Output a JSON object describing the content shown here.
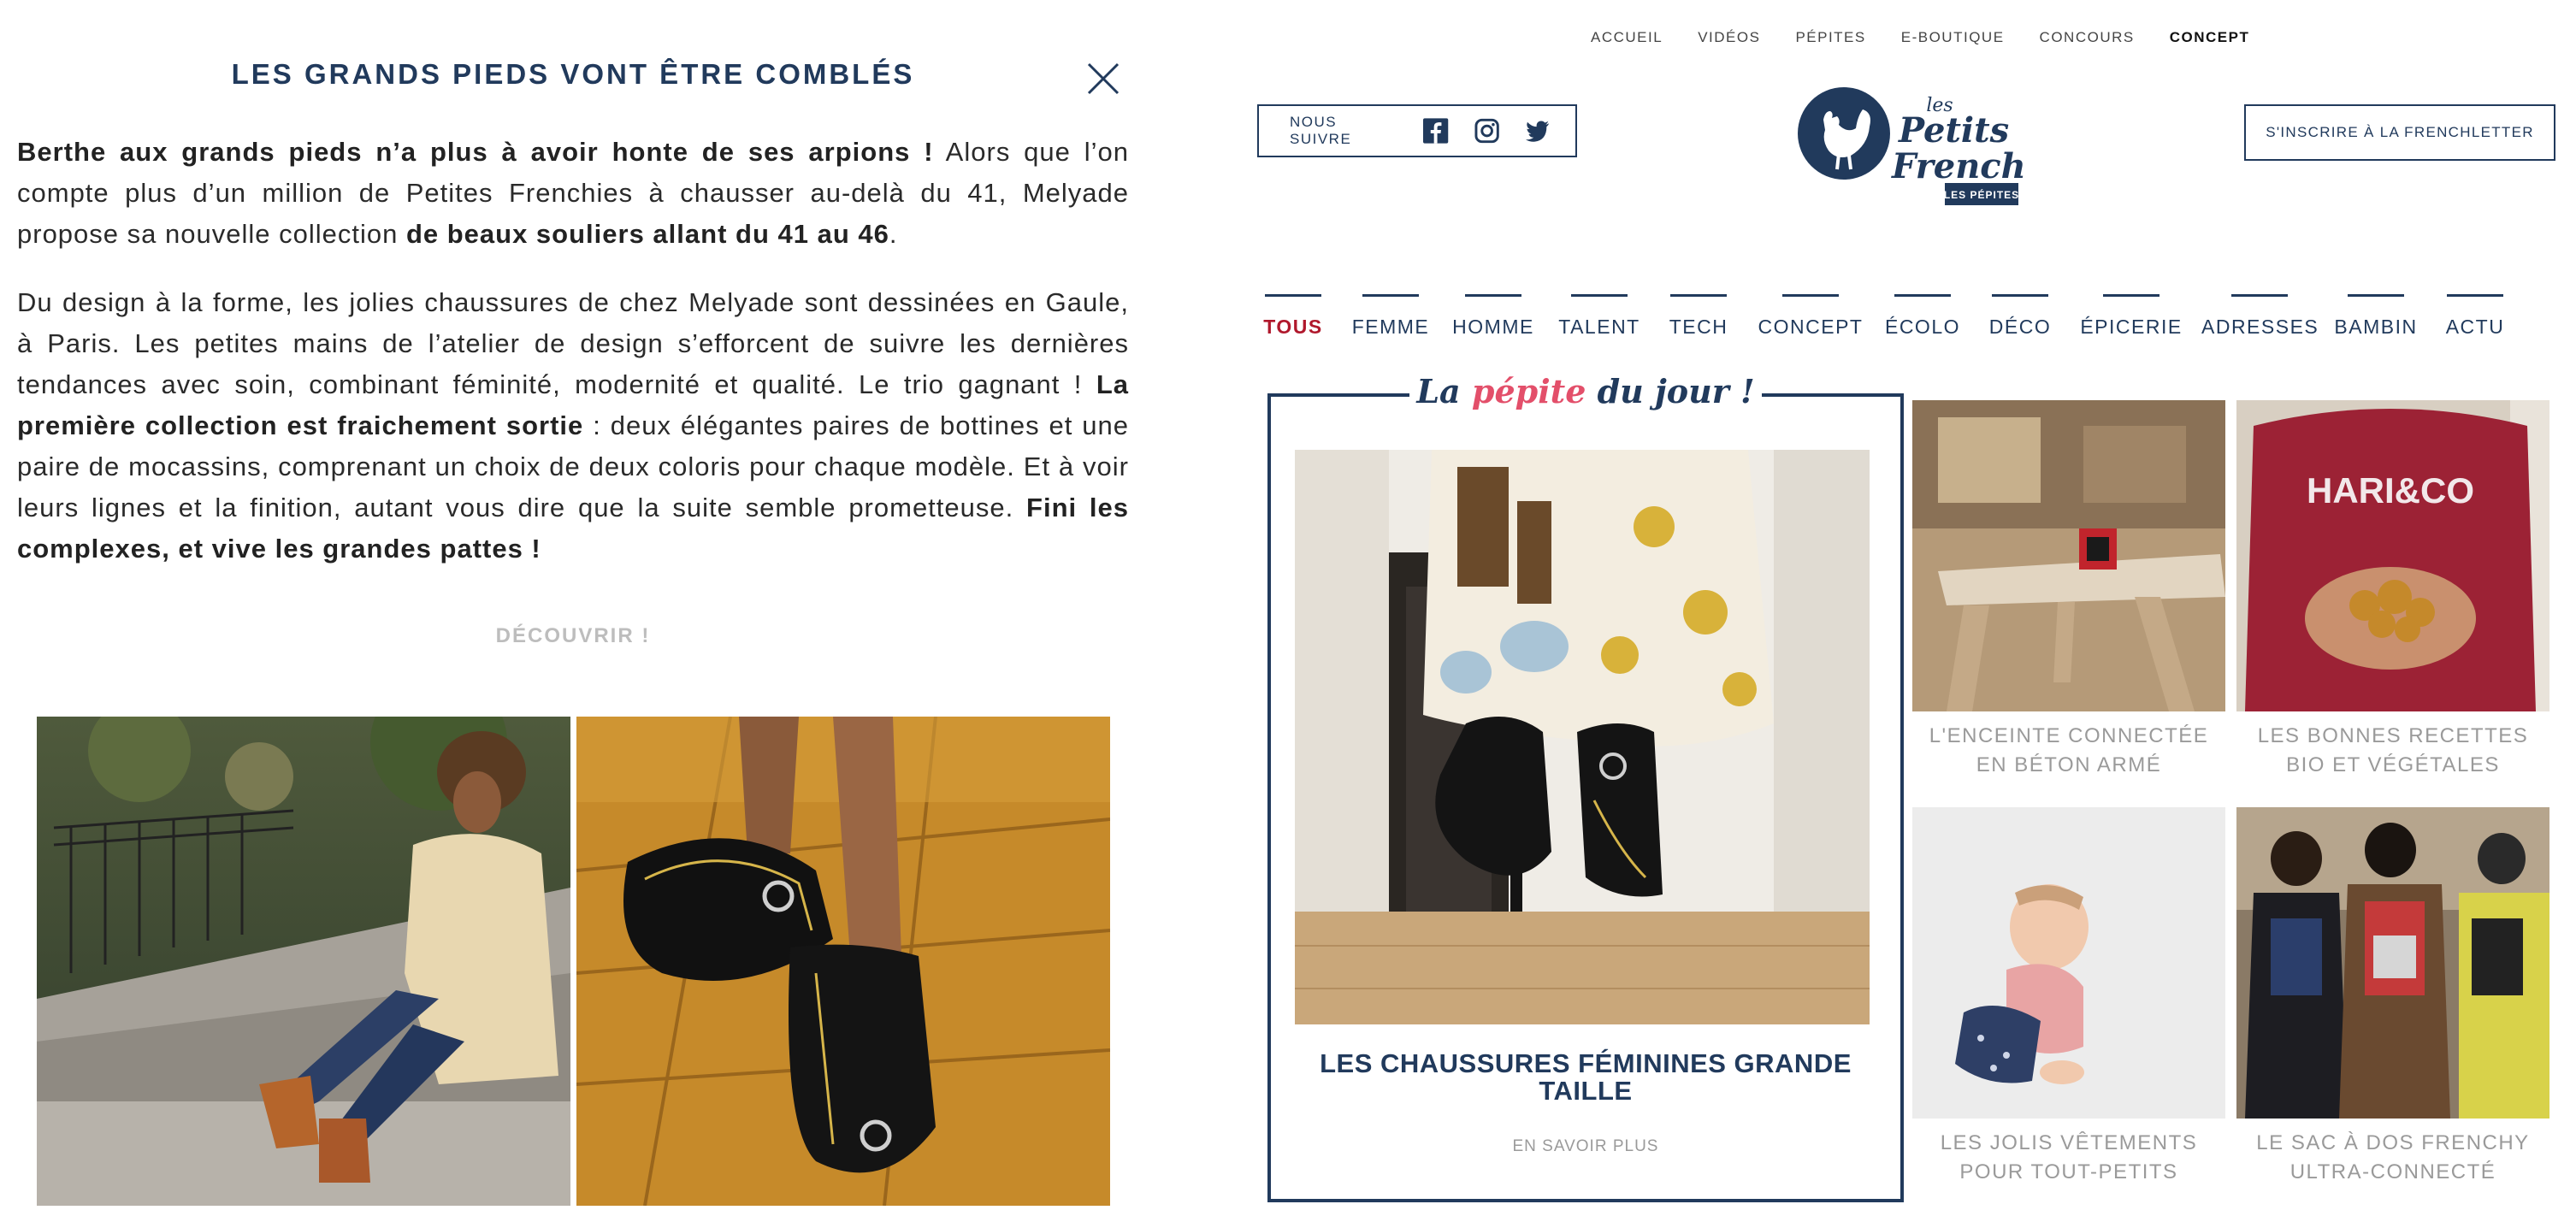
{
  "article": {
    "title": "LES GRANDS PIEDS VONT ÊTRE COMBLÉS",
    "p1": {
      "b1": "Berthe aux grands pieds n’a plus à avoir honte de ses arpions !",
      "t1": " Alors que l’on compte plus d’un million de Petites Frenchies à chausser au-delà du 41, Melyade propose sa nouvelle collection ",
      "b2": "de beaux souliers allant du 41 au 46",
      "t2": "."
    },
    "p2": {
      "t1": "Du design à la forme, les jolies chaussures de chez Melyade sont dessinées en Gaule, à Paris. Les petites mains de l’atelier de design s’efforcent de suivre les dernières tendances avec soin, combinant féminité, modernité et qualité. Le trio gagnant ! ",
      "b1": "La première collection est fraichement sortie",
      "t2": " : deux élégantes paires de bottines et une paire de mocassins, comprenant un choix de deux coloris pour chaque modèle. Et à voir leurs lignes et la finition, autant vous dire que la suite semble prometteuse. ",
      "b2": "Fini les complexes, et vive les grandes pattes !"
    },
    "discover_label": "DÉCOUVRIR !"
  },
  "top_nav": [
    "ACCUEIL",
    "VIDÉOS",
    "PÉPITES",
    "E-BOUTIQUE",
    "CONCOURS",
    "CONCEPT"
  ],
  "top_nav_active": "CONCEPT",
  "follow_label": "NOUS SUIVRE",
  "social_icons": [
    "facebook-icon",
    "instagram-icon",
    "twitter-icon"
  ],
  "logo": {
    "small": "les",
    "line1": "Petits",
    "line2": "Frenchies",
    "badge": "LES PÉPITES"
  },
  "newsletter_label": "S'INSCRIRE À LA FRENCHLETTER",
  "categories": [
    "TOUS",
    "FEMME",
    "HOMME",
    "TALENT",
    "TECH",
    "CONCEPT",
    "ÉCOLO",
    "DÉCO",
    "ÉPICERIE",
    "ADRESSES",
    "BAMBIN",
    "ACTU"
  ],
  "category_active": "TOUS",
  "featured": {
    "heading_la": "La ",
    "heading_pepite": "pépite",
    "heading_rest": " du jour !",
    "title": "LES CHAUSSURES FÉMININES GRANDE TAILLE",
    "more": "EN SAVOIR PLUS"
  },
  "cards": [
    {
      "l1": "L'ENCEINTE CONNECTÉE",
      "l2": "EN BÉTON ARMÉ"
    },
    {
      "l1": "LES BONNES RECETTES",
      "l2": "BIO ET VÉGÉTALES"
    },
    {
      "l1": "LES JOLIS VÊTEMENTS",
      "l2": "POUR TOUT-PETITS"
    },
    {
      "l1": "LE SAC À DOS FRENCHY",
      "l2": "ULTRA-CONNECTÉ"
    }
  ],
  "card_image_texts": {
    "sweater_print": "HARI&CO"
  },
  "colors": {
    "navy": "#213a5c",
    "active_red": "#b0182c",
    "pink": "#e34f6a",
    "grey_text": "#9a9a9a"
  }
}
